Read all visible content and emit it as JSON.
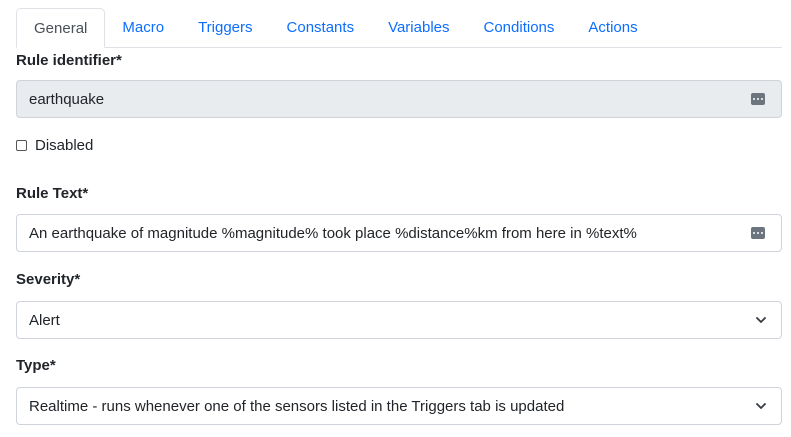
{
  "tabs": [
    {
      "label": "General",
      "active": true
    },
    {
      "label": "Macro",
      "active": false
    },
    {
      "label": "Triggers",
      "active": false
    },
    {
      "label": "Constants",
      "active": false
    },
    {
      "label": "Variables",
      "active": false
    },
    {
      "label": "Conditions",
      "active": false
    },
    {
      "label": "Actions",
      "active": false
    }
  ],
  "form": {
    "rule_identifier": {
      "label": "Rule identifier*",
      "value": "earthquake",
      "icon": "ellipsis-icon"
    },
    "disabled": {
      "label": "Disabled",
      "checked": false
    },
    "rule_text": {
      "label": "Rule Text*",
      "value": "An earthquake of magnitude %magnitude% took place %distance%km from here in %text%",
      "icon": "ellipsis-icon"
    },
    "severity": {
      "label": "Severity*",
      "selected": "Alert"
    },
    "type": {
      "label": "Type*",
      "selected": "Realtime - runs whenever one of the sensors listed in the Triggers tab is updated"
    }
  },
  "colors": {
    "link": "#0d6efd",
    "readonly_bg": "#e9ecef",
    "border": "#ced4da"
  }
}
